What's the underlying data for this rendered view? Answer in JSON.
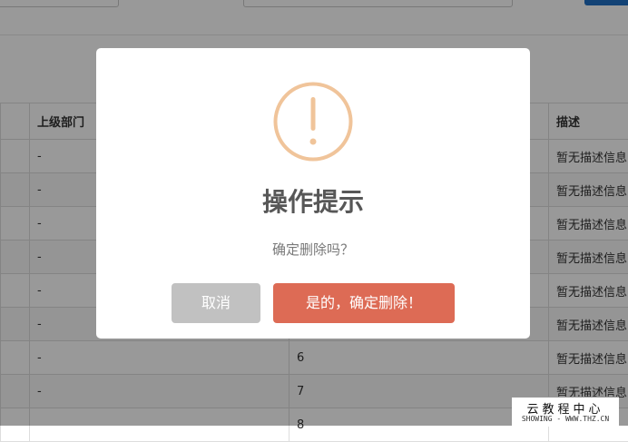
{
  "table": {
    "columns": {
      "parent": "上级部门",
      "desc": "描述"
    },
    "rows": [
      {
        "parent": "-",
        "num": "",
        "desc": "暂无描述信息"
      },
      {
        "parent": "-",
        "num": "",
        "desc": "暂无描述信息"
      },
      {
        "parent": "-",
        "num": "",
        "desc": "暂无描述信息"
      },
      {
        "parent": "-",
        "num": "",
        "desc": "暂无描述信息"
      },
      {
        "parent": "-",
        "num": "",
        "desc": "暂无描述信息"
      },
      {
        "parent": "-",
        "num": "",
        "desc": "暂无描述信息"
      },
      {
        "parent": "-",
        "num": "6",
        "desc": "暂无描述信息"
      },
      {
        "parent": "-",
        "num": "7",
        "desc": "暂无描述信息"
      },
      {
        "parent": "",
        "num": "8",
        "desc": ""
      }
    ]
  },
  "dialog": {
    "icon": "warning-icon",
    "icon_color": "#f0c49a",
    "title": "操作提示",
    "text": "确定删除吗？",
    "cancel_label": "取消",
    "confirm_label": "是的，确定删除！",
    "cancel_color": "#c1c1c1",
    "confirm_color": "#dd6b55"
  },
  "watermark": {
    "line1": "云教程中心",
    "line2": "SHOWING - WWW.THZ.CN"
  }
}
